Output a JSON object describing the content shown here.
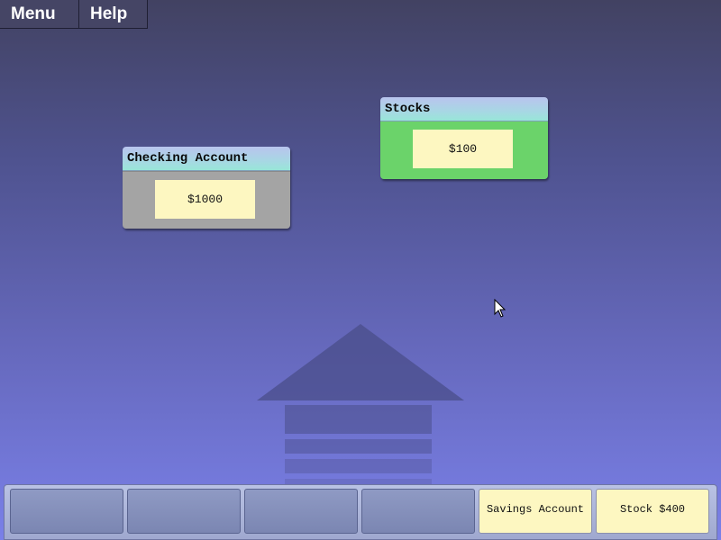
{
  "menubar": {
    "menu_label": "Menu",
    "help_label": "Help"
  },
  "cards": {
    "checking": {
      "title": "Checking Account",
      "value": "$1000"
    },
    "stocks": {
      "title": "Stocks",
      "value": "$100"
    }
  },
  "tray": {
    "slots": [
      {
        "label": ""
      },
      {
        "label": ""
      },
      {
        "label": ""
      },
      {
        "label": ""
      },
      {
        "label": "Savings Account"
      },
      {
        "label": "Stock $400"
      }
    ]
  },
  "colors": {
    "background_top": "#424262",
    "background_bottom": "#7a80e8",
    "checking_body": "#a4a4a4",
    "stocks_body": "#6bd36a",
    "value_box": "#fdf7c1"
  },
  "icons": {
    "watermark": "bank-building-icon",
    "cursor": "mouse-pointer-icon"
  }
}
